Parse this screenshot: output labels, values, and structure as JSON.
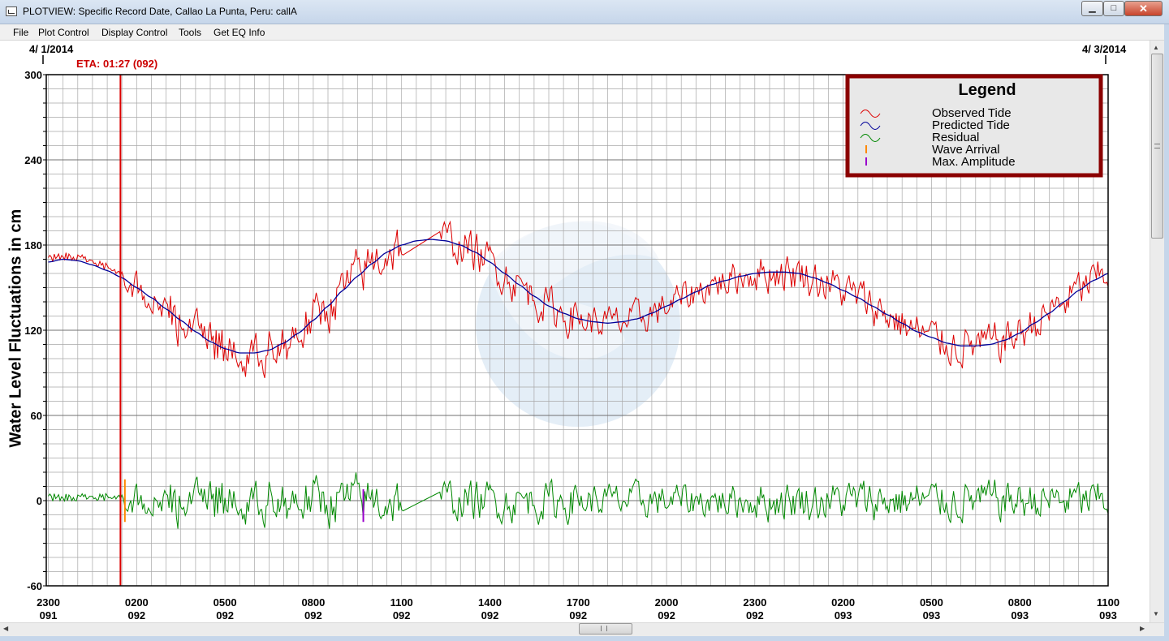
{
  "window": {
    "title": "PLOTVIEW: Specific Record Date, Callao La Punta, Peru: callA",
    "minimize_glyph": "▁",
    "maximize_glyph": "□",
    "close_glyph": "✕"
  },
  "menu": {
    "items": [
      "File",
      "Plot Control",
      "Display Control",
      "Tools",
      "Get EQ Info"
    ]
  },
  "header": {
    "start_date": "4/ 1/2014",
    "end_date": "4/ 3/2014",
    "eta": "ETA: 01:27 (092)"
  },
  "colors": {
    "observed": "#dd0000",
    "predicted": "#000099",
    "residual": "#008800",
    "wave_arrival": "#ff8800",
    "max_amplitude": "#9900cc",
    "eta_line": "#dd0000",
    "legend_border": "#8b0000",
    "legend_bg": "#e8e8e8"
  },
  "chart_data": {
    "type": "line",
    "title": "",
    "ylabel": "Water Level Fluctuations in cm",
    "xlabel": "",
    "ylim": [
      -60,
      300
    ],
    "y_ticks": [
      -60,
      0,
      60,
      120,
      180,
      240,
      300
    ],
    "x_range_hours": [
      -0.07,
      36.0
    ],
    "x_ticks": [
      {
        "h": 0,
        "time": "2300",
        "day": "091"
      },
      {
        "h": 3,
        "time": "0200",
        "day": "092"
      },
      {
        "h": 6,
        "time": "0500",
        "day": "092"
      },
      {
        "h": 9,
        "time": "0800",
        "day": "092"
      },
      {
        "h": 12,
        "time": "1100",
        "day": "092"
      },
      {
        "h": 15,
        "time": "1400",
        "day": "092"
      },
      {
        "h": 18,
        "time": "1700",
        "day": "092"
      },
      {
        "h": 21,
        "time": "2000",
        "day": "092"
      },
      {
        "h": 24,
        "time": "2300",
        "day": "092"
      },
      {
        "h": 27,
        "time": "0200",
        "day": "093"
      },
      {
        "h": 30,
        "time": "0500",
        "day": "093"
      },
      {
        "h": 33,
        "time": "0800",
        "day": "093"
      },
      {
        "h": 36,
        "time": "1100",
        "day": "093"
      }
    ],
    "grid": true,
    "legend": {
      "title": "Legend",
      "position": "top-right",
      "entries": [
        "Observed Tide",
        "Predicted Tide",
        "Residual",
        "Wave Arrival",
        "Max. Amplitude"
      ]
    },
    "eta_hour": 2.45,
    "wave_arrival_hour": 2.6,
    "max_amplitude_hour": 10.7,
    "data_gap_hours": [
      12.1,
      13.3
    ],
    "predicted": {
      "name": "Predicted Tide",
      "x": [
        0,
        0.5,
        1,
        1.5,
        2,
        2.5,
        3,
        3.5,
        4,
        4.5,
        5,
        5.5,
        6,
        6.5,
        7,
        7.5,
        8,
        8.5,
        9,
        9.5,
        10,
        10.5,
        11,
        11.5,
        12,
        12.5,
        13,
        13.5,
        14,
        14.5,
        15,
        15.5,
        16,
        16.5,
        17,
        17.5,
        18,
        18.5,
        19,
        19.5,
        20,
        20.5,
        21,
        21.5,
        22,
        22.5,
        23,
        23.5,
        24,
        24.5,
        25,
        25.5,
        26,
        26.5,
        27,
        27.5,
        28,
        28.5,
        29,
        29.5,
        30,
        30.5,
        31,
        31.5,
        32,
        32.5,
        33,
        33.5,
        34,
        34.5,
        35,
        35.5,
        36
      ],
      "y": [
        168,
        170,
        169,
        166,
        162,
        157,
        150,
        143,
        135,
        127,
        119,
        112,
        107,
        104,
        104,
        106,
        111,
        118,
        127,
        137,
        148,
        158,
        167,
        175,
        180,
        183,
        184,
        183,
        180,
        175,
        168,
        160,
        152,
        144,
        137,
        132,
        128,
        126,
        125,
        126,
        128,
        132,
        137,
        142,
        147,
        152,
        155,
        158,
        160,
        161,
        161,
        160,
        157,
        153,
        148,
        143,
        137,
        131,
        125,
        119,
        115,
        111,
        109,
        109,
        110,
        113,
        118,
        125,
        132,
        140,
        148,
        155,
        160
      ]
    },
    "observed": {
      "name": "Observed Tide",
      "noise_amplitude_cm": [
        5,
        25
      ],
      "spike_max_cm": 203,
      "spike_min_cm": 73
    },
    "residual": {
      "name": "Residual",
      "baseline_cm": 0,
      "range_cm": [
        -30,
        27
      ]
    }
  }
}
